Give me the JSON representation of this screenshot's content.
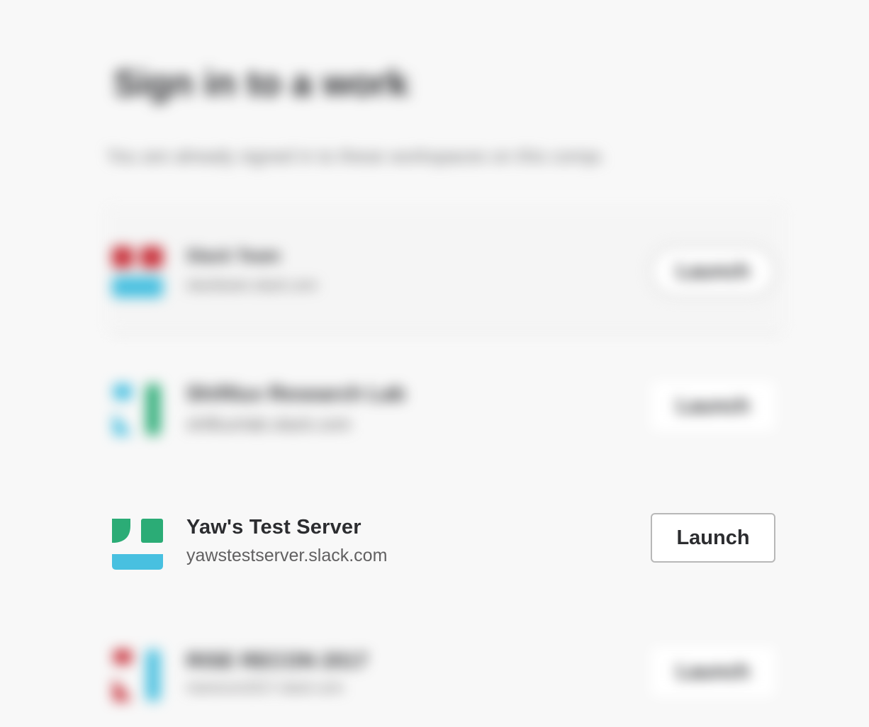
{
  "header": {
    "title": "Sign in to a workspace",
    "subtitle": "You are already signed in to these workspaces on this computer."
  },
  "teams": [
    {
      "name": "Slack Team",
      "domain": "slackteam.slack.com",
      "launch_label": "Launch",
      "icon": "team-icon-red-blue",
      "blurred": true
    },
    {
      "name": "Shiftlux Research Lab",
      "domain": "shiftuxrlab.slack.com",
      "launch_label": "Launch",
      "icon": "team-icon-blue-green",
      "blurred": true
    },
    {
      "name": "Yaw's Test Server",
      "domain": "yawstestserver.slack.com",
      "launch_label": "Launch",
      "icon": "team-icon-green-blue",
      "blurred": false
    },
    {
      "name": "RISE RECON 2017",
      "domain": "riserecon2017.slack.com",
      "launch_label": "Launch",
      "icon": "team-icon-red-blue",
      "blurred": true
    }
  ],
  "colors": {
    "background": "#f8f8f8",
    "green": "#2bac76",
    "blue": "#48c0e0",
    "red": "#c8323c",
    "text_primary": "#2c2d30",
    "text_secondary": "#616061"
  }
}
